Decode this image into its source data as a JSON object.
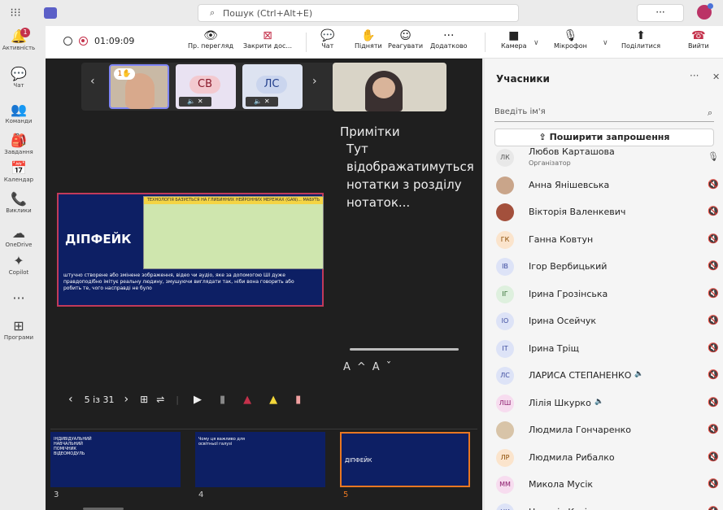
{
  "topbar": {
    "search_placeholder": "Пошук (Ctrl+Alt+E)",
    "more": "···"
  },
  "rail": [
    {
      "label": "Активність",
      "icon": "bell-icon",
      "glyph": "🔔",
      "badge": "1"
    },
    {
      "label": "Чат",
      "icon": "chat-icon",
      "glyph": "💬"
    },
    {
      "label": "Команди",
      "icon": "teams-icon",
      "glyph": "👥"
    },
    {
      "label": "Завдання",
      "icon": "assignments-icon",
      "glyph": "🎒"
    },
    {
      "label": "Календар",
      "icon": "calendar-icon",
      "glyph": "📅"
    },
    {
      "label": "Виклики",
      "icon": "phone-icon",
      "glyph": "📞"
    },
    {
      "label": "OneDrive",
      "icon": "cloud-icon",
      "glyph": "☁"
    },
    {
      "label": "Copilot",
      "icon": "copilot-icon",
      "glyph": "✦"
    },
    {
      "label": "",
      "icon": "more-icon",
      "glyph": "···"
    },
    {
      "label": "Програми",
      "icon": "apps-icon",
      "glyph": "⊞"
    }
  ],
  "toolbar": {
    "timer": "01:09:09",
    "preview": "Пр. перегляд",
    "stop_share": "Закрити дос...",
    "chat": "Чат",
    "raise": "Підняти",
    "react": "Реагувати",
    "more": "Додатково",
    "camera": "Камера",
    "mic": "Мікрофон",
    "share": "Поділитися",
    "leave": "Вийти"
  },
  "tiles": {
    "raised": "1",
    "t2": "СВ",
    "t3": "ЛС"
  },
  "notes": {
    "title": "Примітки",
    "body": "Тут відображатимуться нотатки з розділу нотаток..."
  },
  "slide": {
    "title": "ДІПФЕЙК",
    "caption": "ТЕХНОЛОГІЯ БАЗУЄТЬСЯ НА ГЛИБИННИХ НЕЙРОННИХ МЕРЕЖАХ (GAN)... МАБУТЬ",
    "text": "штучно створене або змінене зображення, відео чи аудіо, яке за допомогою ШІ дуже правдоподібно імітує реальну людину, змушуючи виглядати так, ніби вона говорить або робить те, чого насправді не було"
  },
  "controls": {
    "page": "5 із 31"
  },
  "thumbs": [
    {
      "num": "3",
      "text": "ІНДИВІДУАЛЬНИЙ НАВЧАЛЬНИЙ ПОМІЧНИК ВІДЕОМОДУЛЬ"
    },
    {
      "num": "4",
      "text": "Чому ця важливо для освітньої галузі"
    },
    {
      "num": "5",
      "text": "ДІПФЕЙК"
    }
  ],
  "panel": {
    "title": "Учасники",
    "input_placeholder": "Введіть ім'я",
    "share": "Поширити запрошення",
    "people": [
      {
        "initials": "ЛК",
        "name": "Любов Карташова",
        "sub": "Організатор",
        "bg": "#e8e8e8",
        "fg": "#555"
      },
      {
        "initials": "",
        "name": "Анна Янішевська",
        "bg": "#c9a58a",
        "fg": "#333"
      },
      {
        "initials": "",
        "name": "Вікторія Валенкевич",
        "bg": "#a3503c",
        "fg": "#fff"
      },
      {
        "initials": "ГК",
        "name": "Ганна Ковтун",
        "bg": "#fbe4cc",
        "fg": "#8a4a00"
      },
      {
        "initials": "ІВ",
        "name": "Ігор Вербицький",
        "bg": "#dde3f7",
        "fg": "#3b4a9e"
      },
      {
        "initials": "ІГ",
        "name": "Ірина Грозінська",
        "bg": "#def0de",
        "fg": "#2f6b2f"
      },
      {
        "initials": "ІО",
        "name": "Ірина Осейчук",
        "bg": "#dde3f7",
        "fg": "#3b4a9e"
      },
      {
        "initials": "ІТ",
        "name": "Ірина Тріщ",
        "bg": "#dde3f7",
        "fg": "#3b4a9e"
      },
      {
        "initials": "ЛС",
        "name": "ЛАРИСА СТЕПАНЕНКО",
        "bg": "#dde3f7",
        "fg": "#3b4a9e",
        "extra": "🔈"
      },
      {
        "initials": "ЛШ",
        "name": "Лілія Шкурко",
        "bg": "#f7dcef",
        "fg": "#8b1a6b",
        "extra": "🔈"
      },
      {
        "initials": "",
        "name": "Людмила Гончаренко",
        "bg": "#d8c4a8",
        "fg": "#333"
      },
      {
        "initials": "ЛР",
        "name": "Людмила Рибалко",
        "bg": "#fbe4cc",
        "fg": "#8a4a00"
      },
      {
        "initials": "ММ",
        "name": "Микола Мусік",
        "bg": "#f7dcef",
        "fg": "#8b1a6b"
      },
      {
        "initials": "НК",
        "name": "Наталія Козік",
        "bg": "#dde3f7",
        "fg": "#3b4a9e"
      }
    ]
  }
}
